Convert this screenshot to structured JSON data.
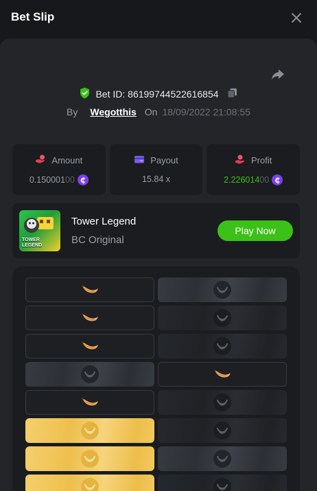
{
  "header": {
    "title": "Bet Slip"
  },
  "bet": {
    "id_label": "Bet ID: 86199744522616854",
    "by_label": "By",
    "user": "Wegotthis",
    "on_label": "On",
    "date": "18/09/2022 21:08:55"
  },
  "stats": {
    "amount": {
      "label": "Amount",
      "value_main": "0.150001",
      "value_dim": "00"
    },
    "payout": {
      "label": "Payout",
      "value": "15.84 x"
    },
    "profit": {
      "label": "Profit",
      "value_main": "2.226014",
      "value_dim": "00"
    }
  },
  "coin_symbol": "₵",
  "game": {
    "thumb_label_1": "TOWER",
    "thumb_label_2": "LEGEND",
    "name": "Tower Legend",
    "subtitle": "BC Original",
    "play_label": "Play Now"
  },
  "colors": {
    "accent_green": "#3bc117",
    "coin_purple": "#7b3ff2",
    "tile_gold": "#eebf4d"
  },
  "grid_rows": [
    [
      "banana",
      "logo-grey"
    ],
    [
      "banana",
      "logo-dark"
    ],
    [
      "banana",
      "logo-dark"
    ],
    [
      "logo-grey",
      "banana"
    ],
    [
      "banana",
      "logo-dark"
    ],
    [
      "logo-gold",
      "logo-dark"
    ],
    [
      "logo-gold",
      "logo-grey"
    ],
    [
      "logo-gold",
      "logo-dark"
    ]
  ]
}
